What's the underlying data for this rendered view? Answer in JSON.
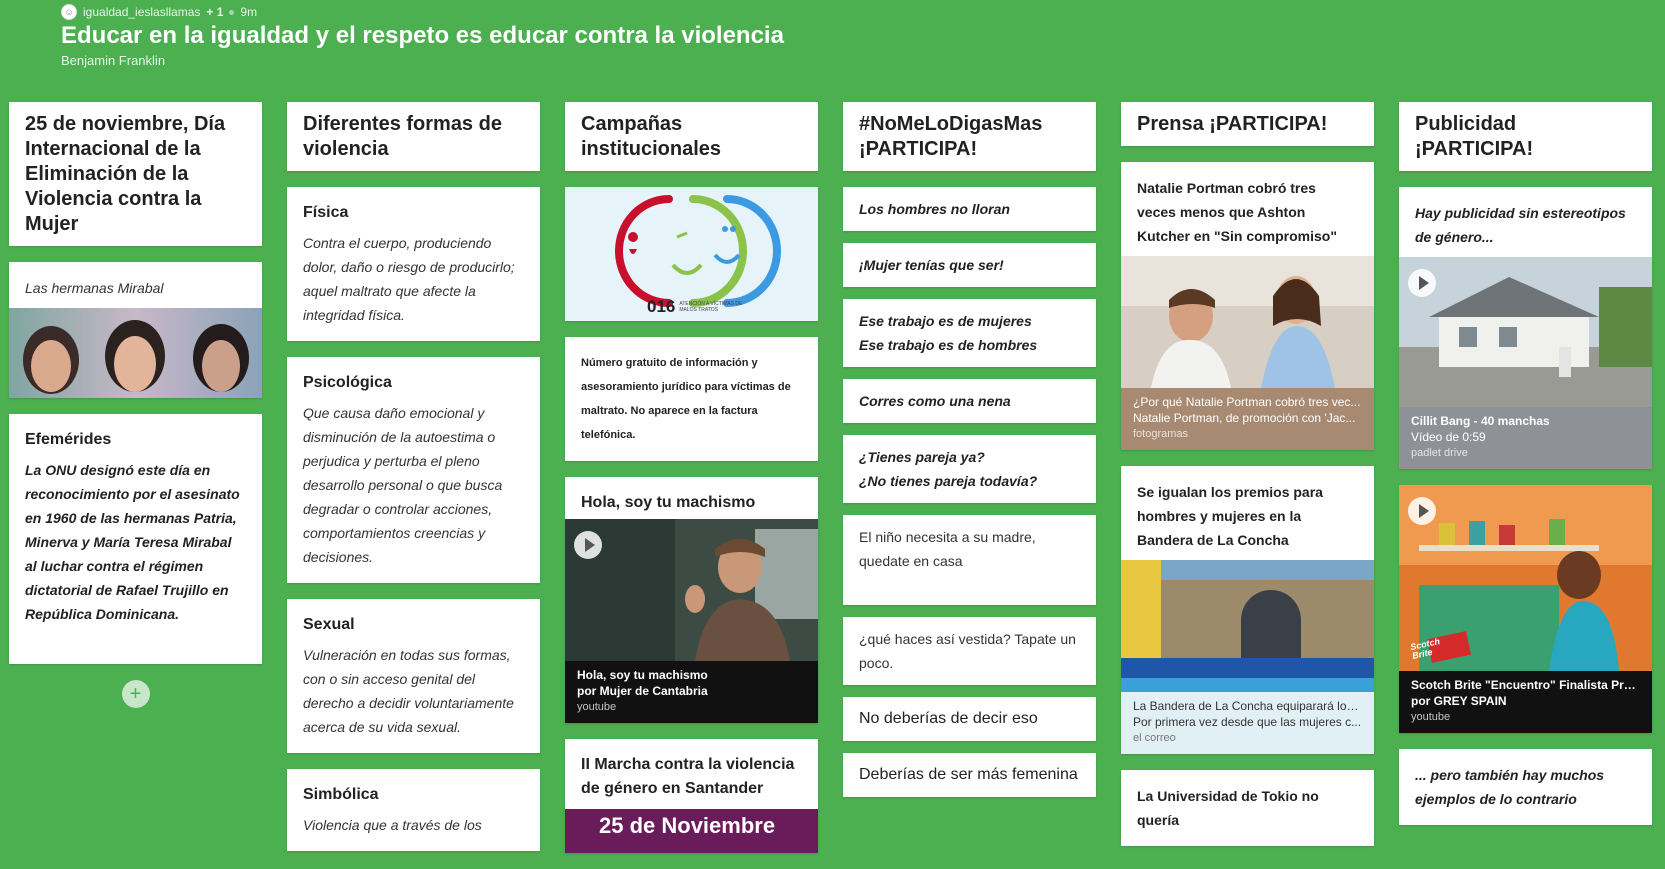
{
  "header": {
    "author": "igualdad_ieslasllamas",
    "collaborators": "+ 1",
    "time_ago": "9m",
    "title": "Educar en la igualdad y el respeto es educar contra la violencia",
    "subtitle": "Benjamin Franklin"
  },
  "columns": [
    {
      "title": "25 de noviembre, Día Internacional de la Eliminación de la Violencia contra la Mujer",
      "cards": [
        {
          "body": "Las hermanas Mirabal"
        },
        {
          "title": "Efemérides",
          "body": "La ONU designó este día en reconocimiento por el asesinato en 1960 de las hermanas Patria, Minerva y María Teresa Mirabal al luchar contra el régimen dictatorial de Rafael Trujillo en República Dominicana."
        }
      ],
      "add_label": "+"
    },
    {
      "title": "Diferentes formas de violencia",
      "cards": [
        {
          "title": "Física",
          "body": "Contra el cuerpo, produciendo dolor, daño o riesgo de producirlo; aquel maltrato que afecte la integridad física."
        },
        {
          "title": "Psicológica",
          "body": "Que causa daño emocional y disminución de la autoestima o perjudica y perturba el pleno desarrollo personal o que busca degradar o controlar acciones, comportamientos creencias y decisiones."
        },
        {
          "title": "Sexual",
          "body": "Vulneración en todas sus formas, con o sin acceso genital del derecho a decidir voluntariamente acerca de su vida sexual."
        },
        {
          "title": "Simbólica",
          "body": "Violencia que a través de los"
        }
      ]
    },
    {
      "title": "Campañas institucionales",
      "cards": [
        {
          "logo_number": "016",
          "logo_caption": "ATENCIÓN A VÍCTIMAS DE MALOS TRATOS"
        },
        {
          "body": "Número gratuito de información y asesoramiento jurídico para víctimas de maltrato. No aparece en la factura telefónica."
        },
        {
          "title": "Hola, soy tu machismo",
          "att_title": "Hola, soy tu machismo",
          "att_sub": "por Mujer de Cantabria",
          "att_src": "youtube"
        },
        {
          "title": "II Marcha contra la violencia de género en Santander",
          "banner": "25 de Noviembre"
        }
      ]
    },
    {
      "title": "#NoMeLoDigasMas ¡PARTICIPA!",
      "cards": [
        {
          "line1": "Los hombres no lloran"
        },
        {
          "line1": "¡Mujer tenías que ser!"
        },
        {
          "line1": "Ese trabajo es de mujeres",
          "line2": "Ese trabajo es de hombres"
        },
        {
          "line1": "Corres como una nena"
        },
        {
          "line1": "¿Tienes pareja ya?",
          "line2": "¿No tienes pareja todavía?"
        },
        {
          "line1": "El niño necesita a su madre, quedate en casa"
        },
        {
          "line1": "¿qué haces así vestida? Tapate un poco."
        },
        {
          "line1": "No deberías de decir eso"
        },
        {
          "line1": "Deberías de ser más femenina"
        }
      ]
    },
    {
      "title": "Prensa ¡PARTICIPA!",
      "cards": [
        {
          "title": "Natalie Portman cobró tres veces menos que Ashton Kutcher en \"Sin compromiso\"",
          "att_title": "¿Por qué Natalie Portman cobró tres vec...",
          "att_sub": "Natalie Portman, de promoción con 'Jac...",
          "att_src": "fotogramas"
        },
        {
          "title": "Se igualan los premios para hombres y mujeres en la Bandera de La Concha",
          "att_title": "La Bandera de La Concha equiparará los...",
          "att_sub": "Por primera vez desde que las mujeres c...",
          "att_src": "el correo"
        },
        {
          "title": "La Universidad de Tokio no quería"
        }
      ]
    },
    {
      "title": "Publicidad ¡PARTICIPA!",
      "cards": [
        {
          "title": "Hay publicidad sin estereotipos de género...",
          "att_title": "Cillit Bang - 40 manchas",
          "att_sub": "Vídeo de 0:59",
          "att_src": "padlet drive"
        },
        {
          "att_title": "Scotch Brite \"Encuentro\" Finalista Premi...",
          "att_sub": "por GREY SPAIN",
          "att_src": "youtube",
          "brand": "Scotch Brite"
        },
        {
          "title": "... pero también hay muchos ejemplos de lo contrario"
        }
      ]
    }
  ],
  "colors": {
    "background": "#4CAF50",
    "card": "#ffffff",
    "logo_red": "#c8102e",
    "logo_green": "#8bc34a",
    "logo_blue": "#3b9ae1"
  }
}
